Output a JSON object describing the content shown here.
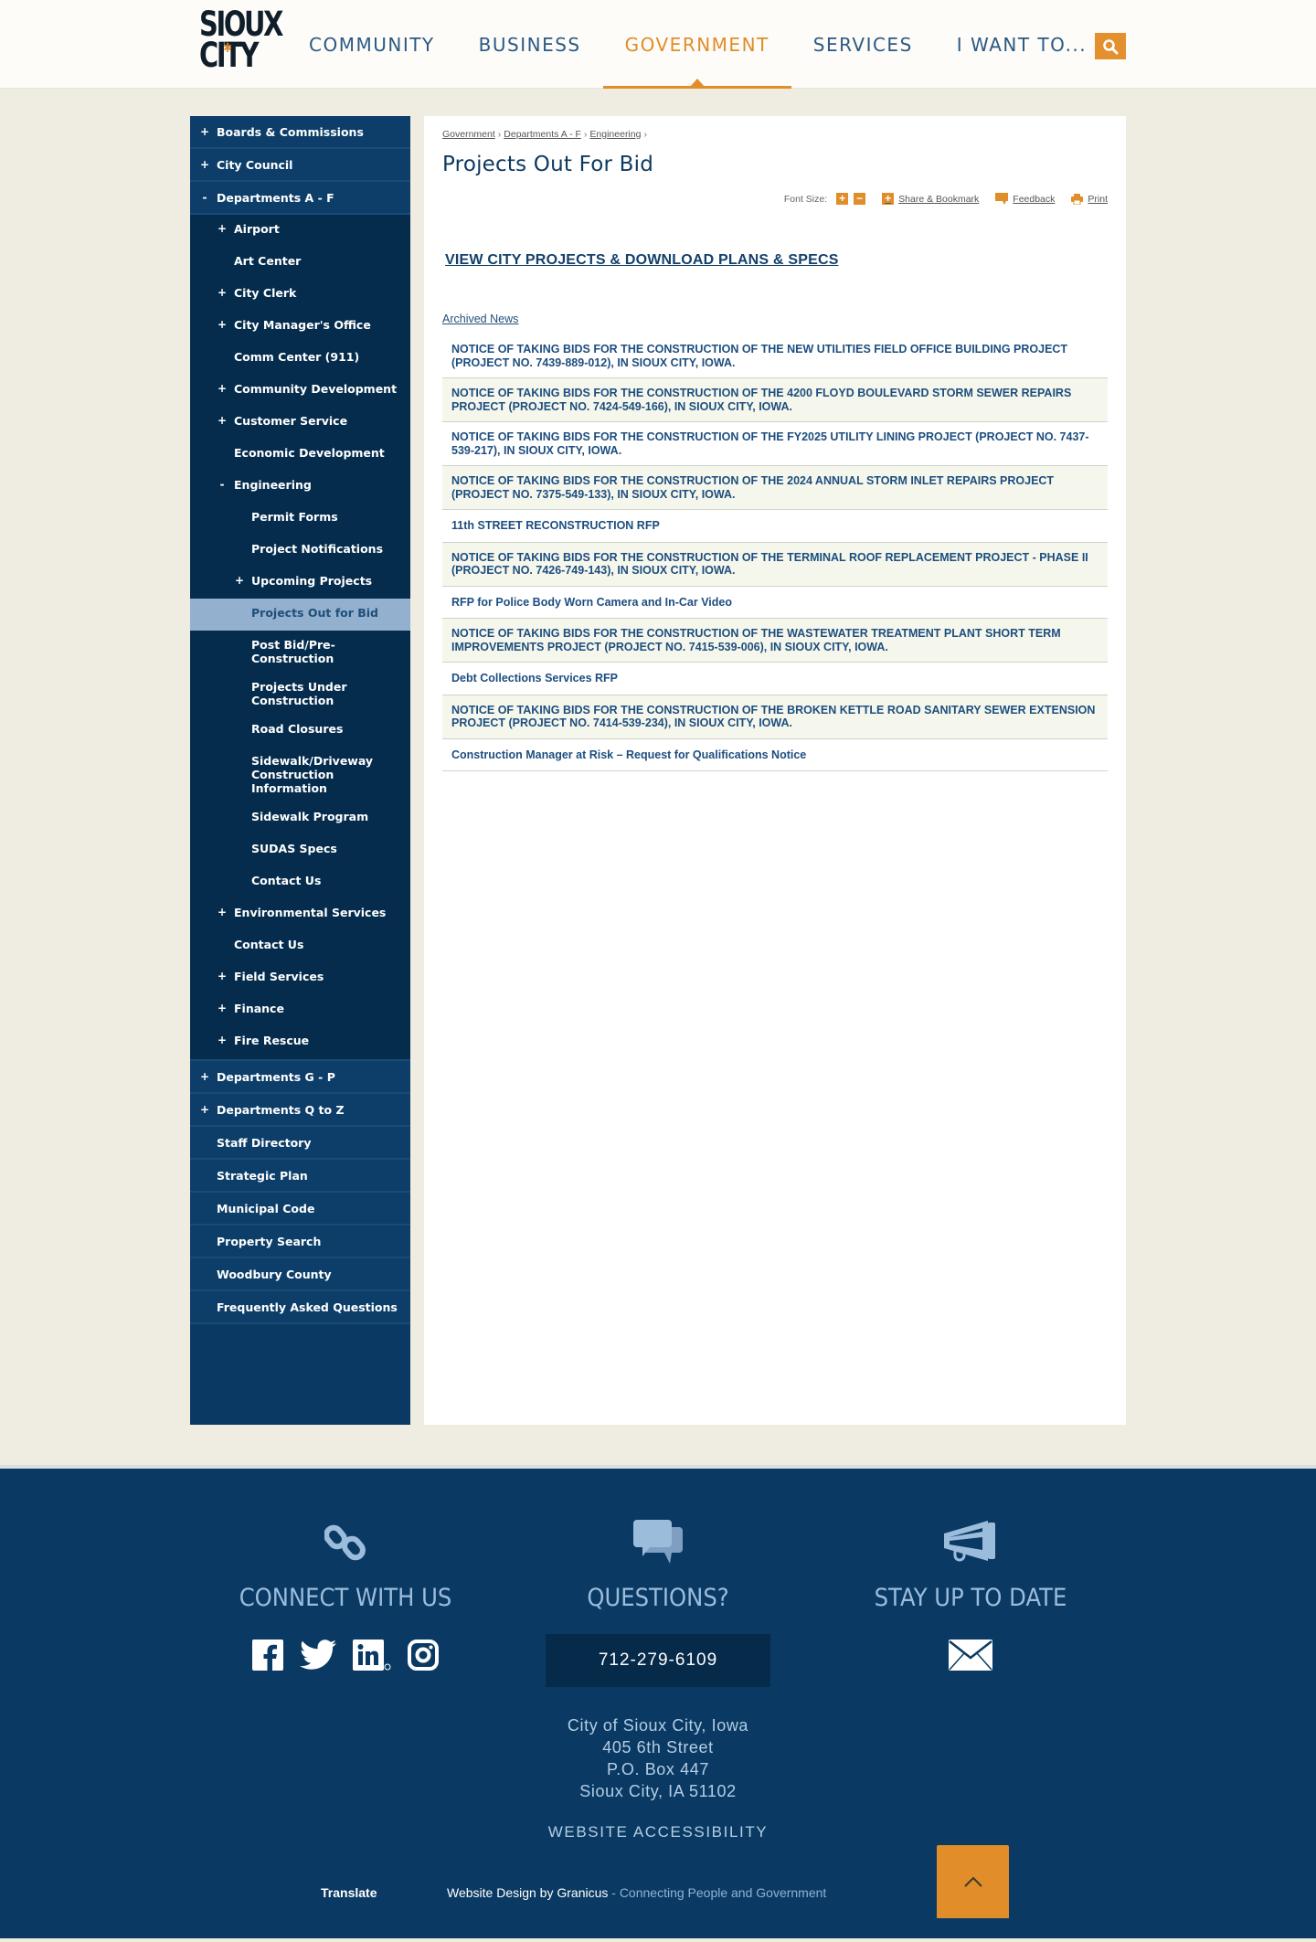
{
  "header": {
    "logo": {
      "line1": "SIOUX",
      "line2": "CITY",
      "alt": "Sioux City"
    },
    "nav": [
      {
        "label": "COMMUNITY",
        "active": false
      },
      {
        "label": "BUSINESS",
        "active": false
      },
      {
        "label": "GOVERNMENT",
        "active": true
      },
      {
        "label": "SERVICES",
        "active": false
      },
      {
        "label": "I WANT TO...",
        "active": false
      }
    ],
    "search_icon": "search-icon"
  },
  "sidebar": {
    "top_items": [
      {
        "label": "Boards & Commissions",
        "toggle": "+"
      },
      {
        "label": "City Council",
        "toggle": "+"
      },
      {
        "label": "Departments A - F",
        "toggle": "-"
      }
    ],
    "dept_af_items": [
      {
        "label": "Airport",
        "toggle": "+"
      },
      {
        "label": "Art Center",
        "toggle": ""
      },
      {
        "label": "City Clerk",
        "toggle": "+"
      },
      {
        "label": "City Manager's Office",
        "toggle": "+"
      },
      {
        "label": "Comm Center (911)",
        "toggle": ""
      },
      {
        "label": "Community Development",
        "toggle": "+"
      },
      {
        "label": "Customer Service",
        "toggle": "+"
      },
      {
        "label": "Economic Development",
        "toggle": ""
      },
      {
        "label": "Engineering",
        "toggle": "-"
      }
    ],
    "engineering_items": [
      {
        "label": "Permit Forms",
        "toggle": ""
      },
      {
        "label": "Project Notifications",
        "toggle": ""
      },
      {
        "label": "Upcoming Projects",
        "toggle": "+"
      },
      {
        "label": "Projects Out for Bid",
        "toggle": "",
        "current": true
      },
      {
        "label": "Post Bid/Pre-Construction",
        "toggle": ""
      },
      {
        "label": "Projects Under Construction",
        "toggle": ""
      },
      {
        "label": "Road Closures",
        "toggle": ""
      },
      {
        "label": "Sidewalk/Driveway Construction Information",
        "toggle": ""
      },
      {
        "label": "Sidewalk Program",
        "toggle": ""
      },
      {
        "label": "SUDAS Specs",
        "toggle": ""
      },
      {
        "label": "Contact Us",
        "toggle": ""
      }
    ],
    "dept_af_after": [
      {
        "label": "Environmental Services",
        "toggle": "+"
      },
      {
        "label": "Contact Us",
        "toggle": ""
      },
      {
        "label": "Field Services",
        "toggle": "+"
      },
      {
        "label": "Finance",
        "toggle": "+"
      },
      {
        "label": "Fire Rescue",
        "toggle": "+"
      }
    ],
    "bottom_items": [
      {
        "label": "Departments G - P",
        "toggle": "+"
      },
      {
        "label": "Departments Q to Z",
        "toggle": "+"
      },
      {
        "label": "Staff Directory",
        "toggle": ""
      },
      {
        "label": "Strategic Plan",
        "toggle": ""
      },
      {
        "label": "Municipal Code",
        "toggle": ""
      },
      {
        "label": "Property Search",
        "toggle": ""
      },
      {
        "label": "Woodbury County",
        "toggle": ""
      },
      {
        "label": "Frequently Asked Questions",
        "toggle": ""
      }
    ]
  },
  "content": {
    "breadcrumb": [
      {
        "label": "Government"
      },
      {
        "label": "Departments A - F"
      },
      {
        "label": "Engineering"
      }
    ],
    "breadcrumb_sep": "›",
    "title": "Projects Out For Bid",
    "tools": {
      "font_size_label": "Font Size:",
      "increase": "+",
      "decrease": "−",
      "share_label": "Share & Bookmark",
      "feedback_label": "Feedback",
      "print_label": "Print"
    },
    "view_projects_link": "VIEW CITY PROJECTS & DOWNLOAD PLANS & SPECS",
    "archived_link": "Archived News",
    "news": [
      "NOTICE OF TAKING BIDS FOR THE CONSTRUCTION OF THE NEW UTILITIES FIELD OFFICE BUILDING PROJECT (PROJECT NO. 7439-889-012), IN SIOUX CITY, IOWA.",
      "NOTICE OF TAKING BIDS FOR THE CONSTRUCTION OF THE 4200 FLOYD BOULEVARD STORM SEWER REPAIRS PROJECT (PROJECT NO. 7424-549-166), IN SIOUX CITY, IOWA.",
      "NOTICE OF TAKING BIDS FOR THE CONSTRUCTION OF THE FY2025 UTILITY LINING PROJECT (PROJECT NO. 7437-539-217), IN SIOUX CITY, IOWA.",
      "NOTICE OF TAKING BIDS FOR THE CONSTRUCTION OF THE 2024 ANNUAL STORM INLET REPAIRS PROJECT (PROJECT NO. 7375-549-133), IN SIOUX CITY, IOWA.",
      "11th STREET RECONSTRUCTION RFP",
      "NOTICE OF TAKING BIDS FOR THE CONSTRUCTION OF THE TERMINAL ROOF REPLACEMENT PROJECT - PHASE II (PROJECT NO. 7426-749-143), IN SIOUX CITY, IOWA.",
      "RFP for Police Body Worn Camera and In-Car Video",
      "NOTICE OF TAKING BIDS FOR THE CONSTRUCTION OF THE WASTEWATER TREATMENT PLANT SHORT TERM IMPROVEMENTS PROJECT (PROJECT NO. 7415-539-006), IN SIOUX CITY, IOWA.",
      "Debt Collections Services RFP",
      "NOTICE OF TAKING BIDS FOR THE CONSTRUCTION OF THE BROKEN KETTLE ROAD SANITARY SEWER EXTENSION PROJECT (PROJECT NO. 7414-539-234), IN SIOUX CITY, IOWA.",
      "Construction Manager at Risk – Request for Qualifications Notice"
    ]
  },
  "footer": {
    "connect": {
      "icon": "link-icon",
      "heading": "CONNECT WITH US",
      "social": [
        "facebook-icon",
        "twitter-icon",
        "linkedin-icon",
        "instagram-icon"
      ]
    },
    "questions": {
      "icon": "chat-bubbles-icon",
      "heading": "QUESTIONS?",
      "phone": "712-279-6109"
    },
    "stay": {
      "icon": "megaphone-icon",
      "heading": "STAY UP TO DATE",
      "email_icon": "envelope-icon"
    },
    "address": [
      "City of Sioux City, Iowa",
      "405 6th Street",
      "P.O. Box 447",
      "Sioux City, IA 51102"
    ],
    "accessibility": "WEBSITE ACCESSIBILITY",
    "translate": "Translate",
    "credit": {
      "prefix": "Website Design by Granicus",
      "tagline": " - Connecting People and Government"
    },
    "back_to_top_icon": "chevron-up-icon"
  },
  "colors": {
    "brand_navy": "#0a3a63",
    "accent_orange": "#e08d2a",
    "page_bg": "#efece2",
    "sidebar_current": "#93b1cf",
    "footer_text": "#9cbcdc"
  }
}
